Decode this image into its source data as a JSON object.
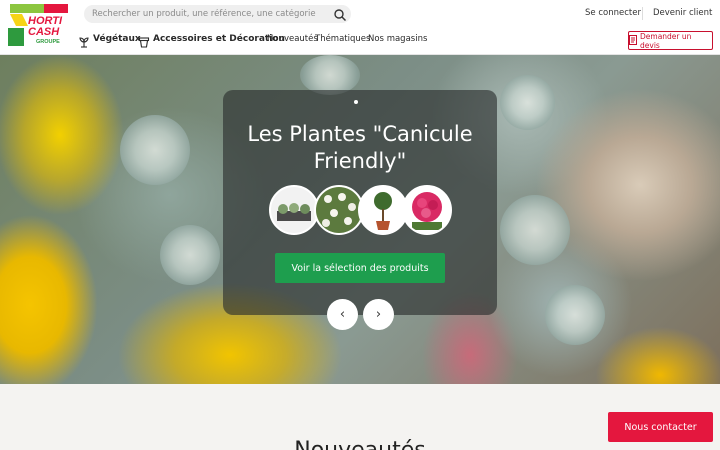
{
  "brand": {
    "logo_line1": "HORTI",
    "logo_line2": "CASH",
    "logo_line3": "GROUPE",
    "colors": {
      "green": "#8cc63f",
      "yellow": "#f7d417",
      "red": "#e4173e"
    }
  },
  "search": {
    "placeholder": "Rechercher un produit, une référence, une catégorie",
    "icon": "search-icon"
  },
  "account": {
    "login_label": "Se connecter",
    "register_label": "Devenir client"
  },
  "nav": {
    "items": [
      {
        "label": "Végétaux",
        "icon": "plant-icon"
      },
      {
        "label": "Accessoires et Décoration",
        "icon": "pot-icon"
      },
      {
        "label": "Nouveautés"
      },
      {
        "label": "Thématiques"
      },
      {
        "label": "Nos magasins"
      }
    ],
    "quote_button": {
      "label": "Demander un devis",
      "icon": "document-icon"
    }
  },
  "hero": {
    "title": "Les Plantes \"Canicule Friendly\"",
    "cta_label": "Voir la sélection des produits",
    "cta_color": "#1e9e4e",
    "prev_icon": "chevron-left-icon",
    "next_icon": "chevron-right-icon",
    "prev_glyph": "‹",
    "next_glyph": "›",
    "thumbnails": [
      {
        "name": "succulent-tray"
      },
      {
        "name": "white-flowers"
      },
      {
        "name": "topiary-tree"
      },
      {
        "name": "pink-flower"
      }
    ]
  },
  "section": {
    "heading": "Nouveautés"
  },
  "contact": {
    "label": "Nous contacter",
    "color": "#e4173e"
  }
}
